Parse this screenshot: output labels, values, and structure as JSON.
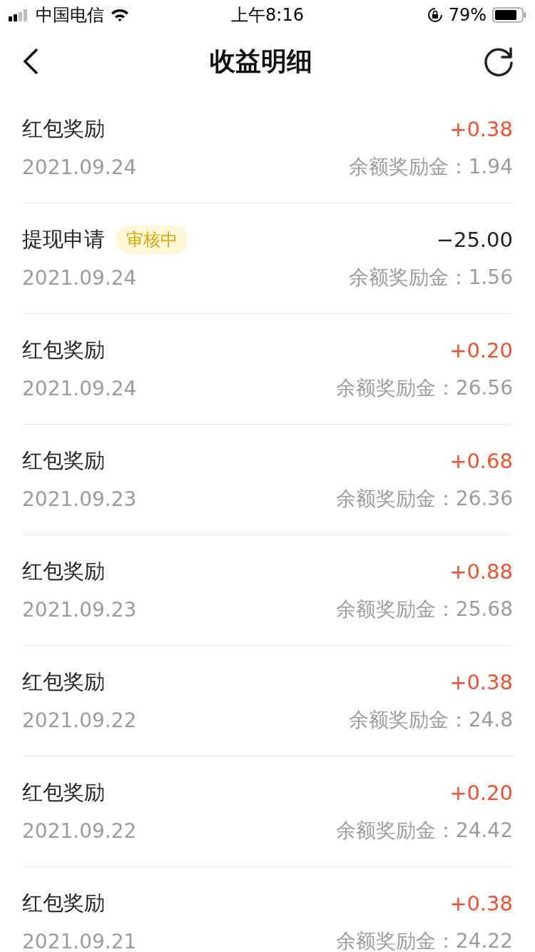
{
  "status_bar": {
    "carrier": "中国电信",
    "time": "上午8:16",
    "battery": "79%"
  },
  "header": {
    "title": "收益明细"
  },
  "entries": [
    {
      "title": "红包奖励",
      "kind": "credit",
      "amount": "+0.38",
      "date": "2021.09.24",
      "balance": "余额奖励金：1.94"
    },
    {
      "title": "提现申请",
      "kind": "debit",
      "badge": "审核中",
      "amount": "−25.00",
      "date": "2021.09.24",
      "balance": "余额奖励金：1.56"
    },
    {
      "title": "红包奖励",
      "kind": "credit",
      "amount": "+0.20",
      "date": "2021.09.24",
      "balance": "余额奖励金：26.56"
    },
    {
      "title": "红包奖励",
      "kind": "credit",
      "amount": "+0.68",
      "date": "2021.09.23",
      "balance": "余额奖励金：26.36"
    },
    {
      "title": "红包奖励",
      "kind": "credit",
      "amount": "+0.88",
      "date": "2021.09.23",
      "balance": "余额奖励金：25.68"
    },
    {
      "title": "红包奖励",
      "kind": "credit",
      "amount": "+0.38",
      "date": "2021.09.22",
      "balance": "余额奖励金：24.8"
    },
    {
      "title": "红包奖励",
      "kind": "credit",
      "amount": "+0.20",
      "date": "2021.09.22",
      "balance": "余额奖励金：24.42"
    },
    {
      "title": "红包奖励",
      "kind": "credit",
      "amount": "+0.38",
      "date": "2021.09.21",
      "balance": "余额奖励金：24.22"
    }
  ]
}
